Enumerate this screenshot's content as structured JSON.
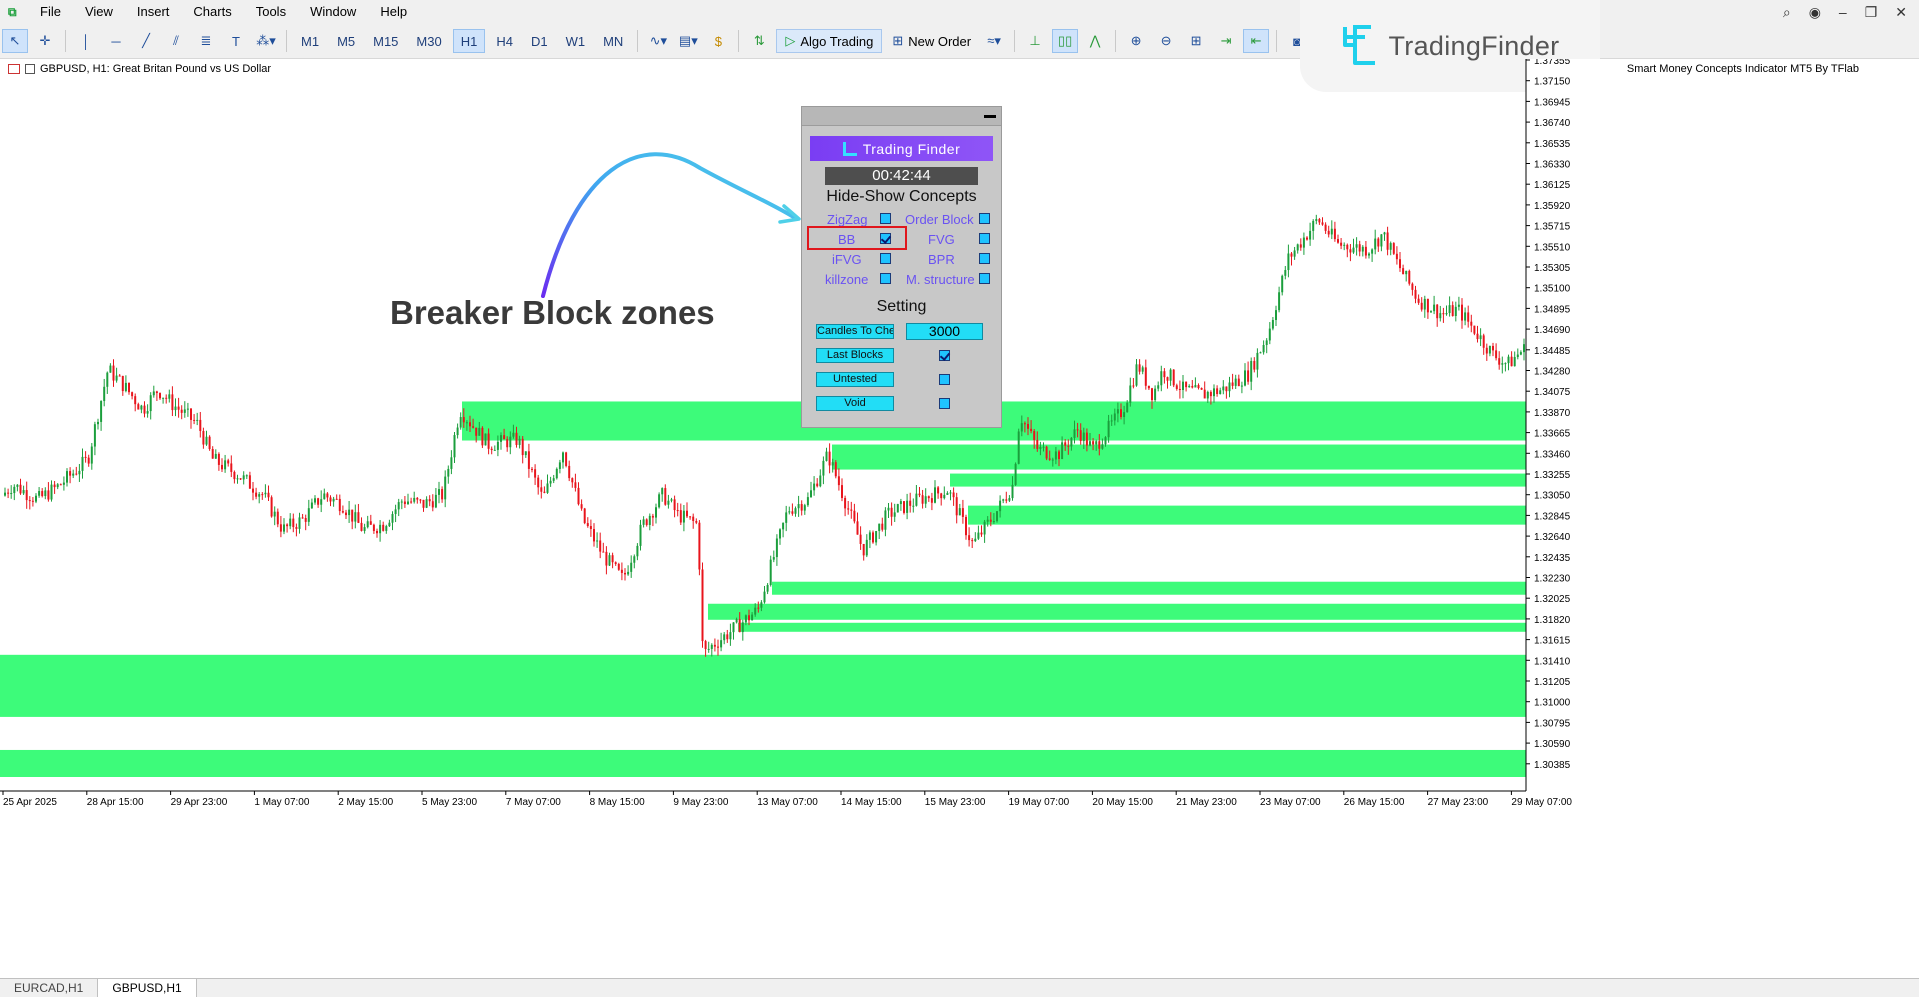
{
  "menu": [
    "File",
    "View",
    "Insert",
    "Charts",
    "Tools",
    "Window",
    "Help"
  ],
  "toolbar": {
    "timeframes": [
      "M1",
      "M5",
      "M15",
      "M30",
      "H1",
      "H4",
      "D1",
      "W1",
      "MN"
    ],
    "selected_timeframe": "H1",
    "algo_trading": "Algo Trading",
    "new_order": "New Order"
  },
  "watermark": {
    "brand": "TradingFinder"
  },
  "chart": {
    "symbol_title": "GBPUSD, H1:  Great Britan Pound vs US Dollar",
    "indicator_title": "Smart Money Concepts Indicator MT5 By TFlab",
    "price_ticks": [
      "1.37355",
      "1.37150",
      "1.36945",
      "1.36740",
      "1.36535",
      "1.36330",
      "1.36125",
      "1.35920",
      "1.35715",
      "1.35510",
      "1.35305",
      "1.35100",
      "1.34895",
      "1.34690",
      "1.34485",
      "1.34280",
      "1.34075",
      "1.33870",
      "1.33665",
      "1.33460",
      "1.33255",
      "1.33050",
      "1.32845",
      "1.32640",
      "1.32435",
      "1.32230",
      "1.32025",
      "1.31820",
      "1.31615",
      "1.31410",
      "1.31205",
      "1.31000",
      "1.30795",
      "1.30590",
      "1.30385"
    ],
    "time_ticks": [
      "25 Apr 2025",
      "28 Apr 15:00",
      "29 Apr 23:00",
      "1 May 07:00",
      "2 May 15:00",
      "5 May 23:00",
      "7 May 07:00",
      "8 May 15:00",
      "9 May 23:00",
      "13 May 07:00",
      "14 May 15:00",
      "15 May 23:00",
      "19 May 07:00",
      "20 May 15:00",
      "21 May 23:00",
      "23 May 07:00",
      "26 May 15:00",
      "27 May 23:00",
      "29 May 07:00"
    ],
    "colors": {
      "bull": "#1b9e3c",
      "bear": "#e8141c",
      "zone": "#3dfb7a"
    }
  },
  "chart_data": {
    "type": "candlestick",
    "symbol": "GBPUSD",
    "timeframe": "H1",
    "ylim": [
      1.302,
      1.3745
    ],
    "path_anchors": [
      [
        0,
        1.3305
      ],
      [
        15,
        1.332
      ],
      [
        40,
        1.3305
      ],
      [
        60,
        1.3318
      ],
      [
        90,
        1.3345
      ],
      [
        110,
        1.3435
      ],
      [
        125,
        1.342
      ],
      [
        145,
        1.3395
      ],
      [
        160,
        1.3415
      ],
      [
        175,
        1.34
      ],
      [
        200,
        1.338
      ],
      [
        215,
        1.3345
      ],
      [
        240,
        1.333
      ],
      [
        265,
        1.331
      ],
      [
        285,
        1.3275
      ],
      [
        305,
        1.3285
      ],
      [
        325,
        1.331
      ],
      [
        345,
        1.33
      ],
      [
        365,
        1.3275
      ],
      [
        385,
        1.328
      ],
      [
        405,
        1.3305
      ],
      [
        425,
        1.33
      ],
      [
        445,
        1.331
      ],
      [
        462,
        1.3395
      ],
      [
        490,
        1.336
      ],
      [
        520,
        1.3365
      ],
      [
        545,
        1.3305
      ],
      [
        565,
        1.3355
      ],
      [
        585,
        1.3285
      ],
      [
        605,
        1.325
      ],
      [
        625,
        1.3225
      ],
      [
        645,
        1.328
      ],
      [
        665,
        1.331
      ],
      [
        680,
        1.329
      ],
      [
        700,
        1.328
      ],
      [
        705,
        1.315
      ],
      [
        715,
        1.316
      ],
      [
        735,
        1.3175
      ],
      [
        760,
        1.3195
      ],
      [
        790,
        1.3295
      ],
      [
        810,
        1.3305
      ],
      [
        830,
        1.335
      ],
      [
        845,
        1.331
      ],
      [
        865,
        1.3255
      ],
      [
        890,
        1.329
      ],
      [
        920,
        1.3305
      ],
      [
        950,
        1.3315
      ],
      [
        975,
        1.326
      ],
      [
        1000,
        1.3295
      ],
      [
        1015,
        1.332
      ],
      [
        1022,
        1.339
      ],
      [
        1040,
        1.3355
      ],
      [
        1060,
        1.335
      ],
      [
        1080,
        1.3375
      ],
      [
        1095,
        1.3355
      ],
      [
        1110,
        1.3375
      ],
      [
        1125,
        1.3395
      ],
      [
        1140,
        1.344
      ],
      [
        1155,
        1.341
      ],
      [
        1165,
        1.3435
      ],
      [
        1185,
        1.3415
      ],
      [
        1205,
        1.341
      ],
      [
        1225,
        1.3415
      ],
      [
        1250,
        1.343
      ],
      [
        1270,
        1.347
      ],
      [
        1290,
        1.3545
      ],
      [
        1305,
        1.3565
      ],
      [
        1320,
        1.3585
      ],
      [
        1340,
        1.356
      ],
      [
        1370,
        1.3555
      ],
      [
        1385,
        1.357
      ],
      [
        1400,
        1.354
      ],
      [
        1420,
        1.3505
      ],
      [
        1445,
        1.349
      ],
      [
        1460,
        1.3495
      ],
      [
        1480,
        1.347
      ],
      [
        1495,
        1.345
      ],
      [
        1510,
        1.344
      ],
      [
        1525,
        1.3455
      ]
    ],
    "breaker_block_zones": [
      {
        "x_start": 462,
        "top": 1.3403,
        "bottom": 1.3364
      },
      {
        "x_start": 832,
        "top": 1.336,
        "bottom": 1.3335
      },
      {
        "x_start": 950,
        "top": 1.3331,
        "bottom": 1.3318
      },
      {
        "x_start": 968,
        "top": 1.3299,
        "bottom": 1.328
      },
      {
        "x_start": 772,
        "top": 1.3223,
        "bottom": 1.321
      },
      {
        "x_start": 708,
        "top": 1.3201,
        "bottom": 1.3185
      },
      {
        "x_start": 738,
        "top": 1.3182,
        "bottom": 1.3173
      },
      {
        "x_start": 0,
        "top": 1.315,
        "bottom": 1.3088
      },
      {
        "x_start": 0,
        "top": 1.3055,
        "bottom": 1.3028
      }
    ]
  },
  "panel": {
    "brand": "Trading Finder",
    "timer": "00:42:44",
    "section1": "Hide-Show Concepts",
    "concepts": [
      {
        "left": "ZigZag",
        "left_checked": false,
        "right": "Order Block",
        "right_checked": false
      },
      {
        "left": "BB",
        "left_checked": true,
        "right": "FVG",
        "right_checked": false
      },
      {
        "left": "iFVG",
        "left_checked": false,
        "right": "BPR",
        "right_checked": false
      },
      {
        "left": "killzone",
        "left_checked": false,
        "right": "M. structure",
        "right_checked": false
      }
    ],
    "section2": "Setting",
    "settings": [
      {
        "label": "Candles To Check",
        "value": "3000"
      },
      {
        "label": "Last Blocks",
        "checked": true
      },
      {
        "label": "Untested",
        "checked": false
      },
      {
        "label": "Void",
        "checked": false
      }
    ]
  },
  "annotation": "Breaker Block zones",
  "tabs": [
    "EURCAD,H1",
    "GBPUSD,H1"
  ],
  "active_tab": "GBPUSD,H1"
}
